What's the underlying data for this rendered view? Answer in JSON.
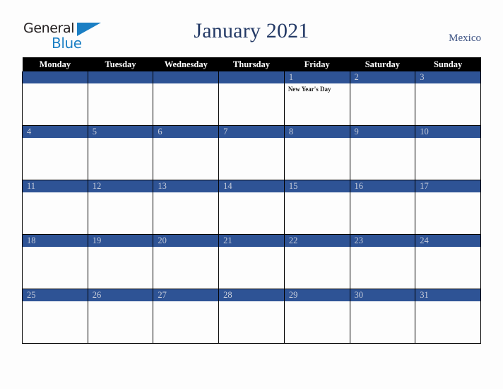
{
  "brand": {
    "name_part1": "General",
    "name_part2": "Blue",
    "accent_color": "#1b7fc4",
    "logo_icon": "triangle-flag-icon"
  },
  "header": {
    "title": "January 2021",
    "country": "Mexico",
    "title_color": "#243a66"
  },
  "calendar": {
    "month": "January",
    "year": "2021",
    "header_background": "#000000",
    "date_bar_color": "#2e5395",
    "date_text_color": "#c6ccda",
    "weekdays": [
      "Monday",
      "Tuesday",
      "Wednesday",
      "Thursday",
      "Friday",
      "Saturday",
      "Sunday"
    ],
    "weeks": [
      [
        {
          "day": "",
          "events": []
        },
        {
          "day": "",
          "events": []
        },
        {
          "day": "",
          "events": []
        },
        {
          "day": "",
          "events": []
        },
        {
          "day": "1",
          "events": [
            "New Year's Day"
          ]
        },
        {
          "day": "2",
          "events": []
        },
        {
          "day": "3",
          "events": []
        }
      ],
      [
        {
          "day": "4",
          "events": []
        },
        {
          "day": "5",
          "events": []
        },
        {
          "day": "6",
          "events": []
        },
        {
          "day": "7",
          "events": []
        },
        {
          "day": "8",
          "events": []
        },
        {
          "day": "9",
          "events": []
        },
        {
          "day": "10",
          "events": []
        }
      ],
      [
        {
          "day": "11",
          "events": []
        },
        {
          "day": "12",
          "events": []
        },
        {
          "day": "13",
          "events": []
        },
        {
          "day": "14",
          "events": []
        },
        {
          "day": "15",
          "events": []
        },
        {
          "day": "16",
          "events": []
        },
        {
          "day": "17",
          "events": []
        }
      ],
      [
        {
          "day": "18",
          "events": []
        },
        {
          "day": "19",
          "events": []
        },
        {
          "day": "20",
          "events": []
        },
        {
          "day": "21",
          "events": []
        },
        {
          "day": "22",
          "events": []
        },
        {
          "day": "23",
          "events": []
        },
        {
          "day": "24",
          "events": []
        }
      ],
      [
        {
          "day": "25",
          "events": []
        },
        {
          "day": "26",
          "events": []
        },
        {
          "day": "27",
          "events": []
        },
        {
          "day": "28",
          "events": []
        },
        {
          "day": "29",
          "events": []
        },
        {
          "day": "30",
          "events": []
        },
        {
          "day": "31",
          "events": []
        }
      ]
    ]
  }
}
